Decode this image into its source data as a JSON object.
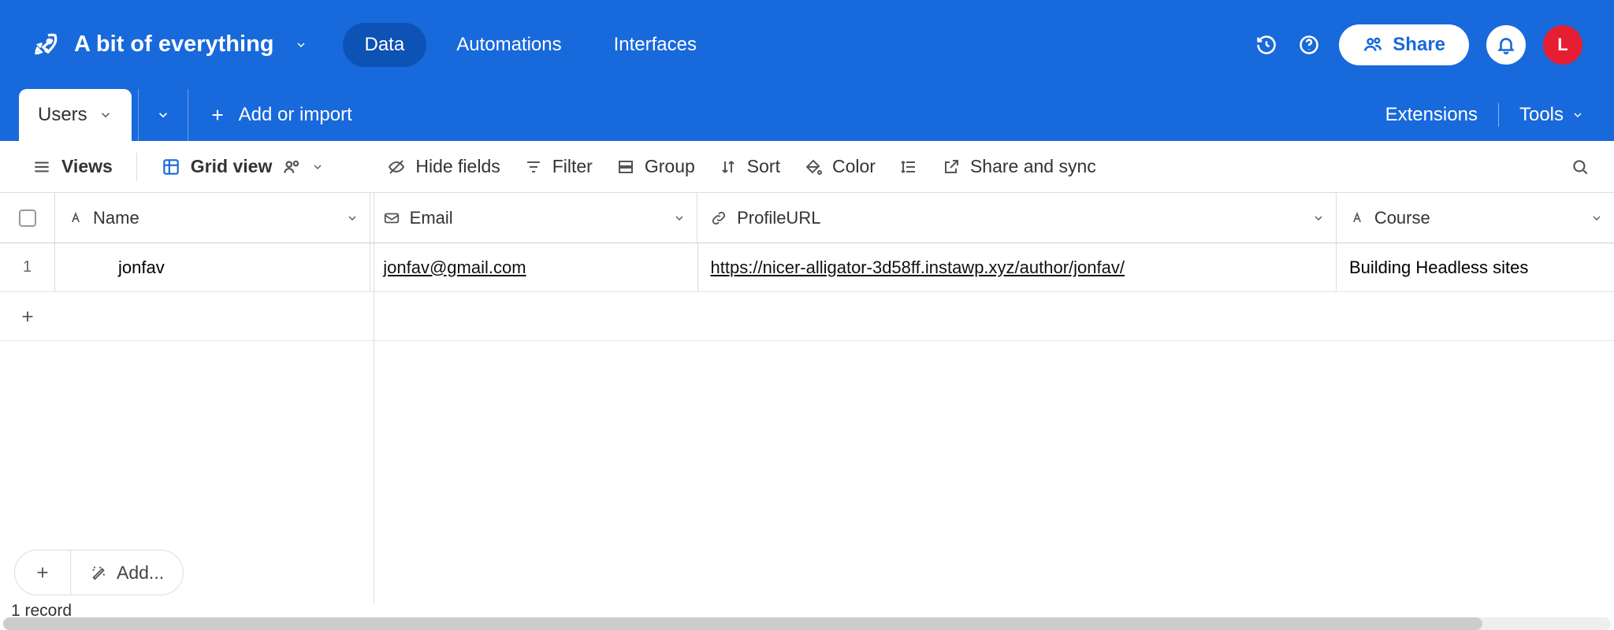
{
  "header": {
    "app_title": "A bit of everything",
    "tabs": {
      "data": "Data",
      "automations": "Automations",
      "interfaces": "Interfaces"
    },
    "share": "Share",
    "avatar_letter": "L"
  },
  "tablebar": {
    "active_table": "Users",
    "add_or_import": "Add or import",
    "extensions": "Extensions",
    "tools": "Tools"
  },
  "toolbar": {
    "views": "Views",
    "grid_view": "Grid view",
    "hide_fields": "Hide fields",
    "filter": "Filter",
    "group": "Group",
    "sort": "Sort",
    "color": "Color",
    "share_sync": "Share and sync"
  },
  "columns": {
    "name": "Name",
    "email": "Email",
    "profile_url": "ProfileURL",
    "course": "Course"
  },
  "rows": [
    {
      "num": "1",
      "name": "jonfav",
      "email": "jonfav@gmail.com",
      "profile_url": "https://nicer-alligator-3d58ff.instawp.xyz/author/jonfav/",
      "course": "Building Headless sites"
    }
  ],
  "footer": {
    "add_label": "Add...",
    "record_count": "1 record"
  }
}
